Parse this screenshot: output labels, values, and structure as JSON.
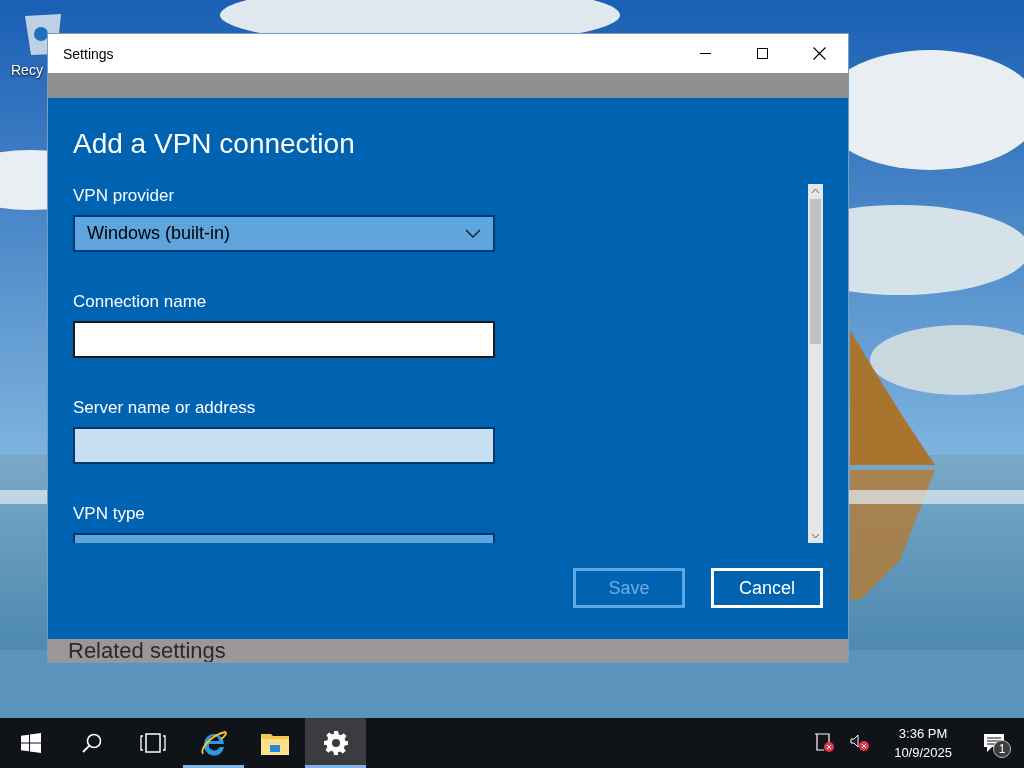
{
  "desktop_icons": [
    {
      "label": "Recy"
    }
  ],
  "window": {
    "title": "Settings",
    "page_heading_behind": "Related settings"
  },
  "dialog": {
    "heading": "Add a VPN connection",
    "fields": [
      {
        "kind": "dropdown",
        "label": "VPN provider",
        "value": "Windows (built-in)",
        "focused": false
      },
      {
        "kind": "text",
        "label": "Connection name",
        "focused": true
      },
      {
        "kind": "text",
        "label": "Server name or address",
        "focused": false
      },
      {
        "kind": "dropdown",
        "label": "VPN type",
        "focused": false
      }
    ],
    "buttons": [
      {
        "label": "Save",
        "disabled": true
      },
      {
        "label": "Cancel",
        "disabled": false
      }
    ]
  },
  "taskbar": {
    "items": [
      {
        "kind": "start",
        "active": false,
        "running": false
      },
      {
        "kind": "search",
        "active": false,
        "running": false
      },
      {
        "kind": "taskview",
        "active": false,
        "running": false
      },
      {
        "kind": "browser",
        "active": false,
        "running": true
      },
      {
        "kind": "folder",
        "active": false,
        "running": false
      },
      {
        "kind": "settings",
        "active": true,
        "running": true
      }
    ],
    "time": "3:36 PM",
    "date": "10/9/2025",
    "notifications": "1"
  }
}
